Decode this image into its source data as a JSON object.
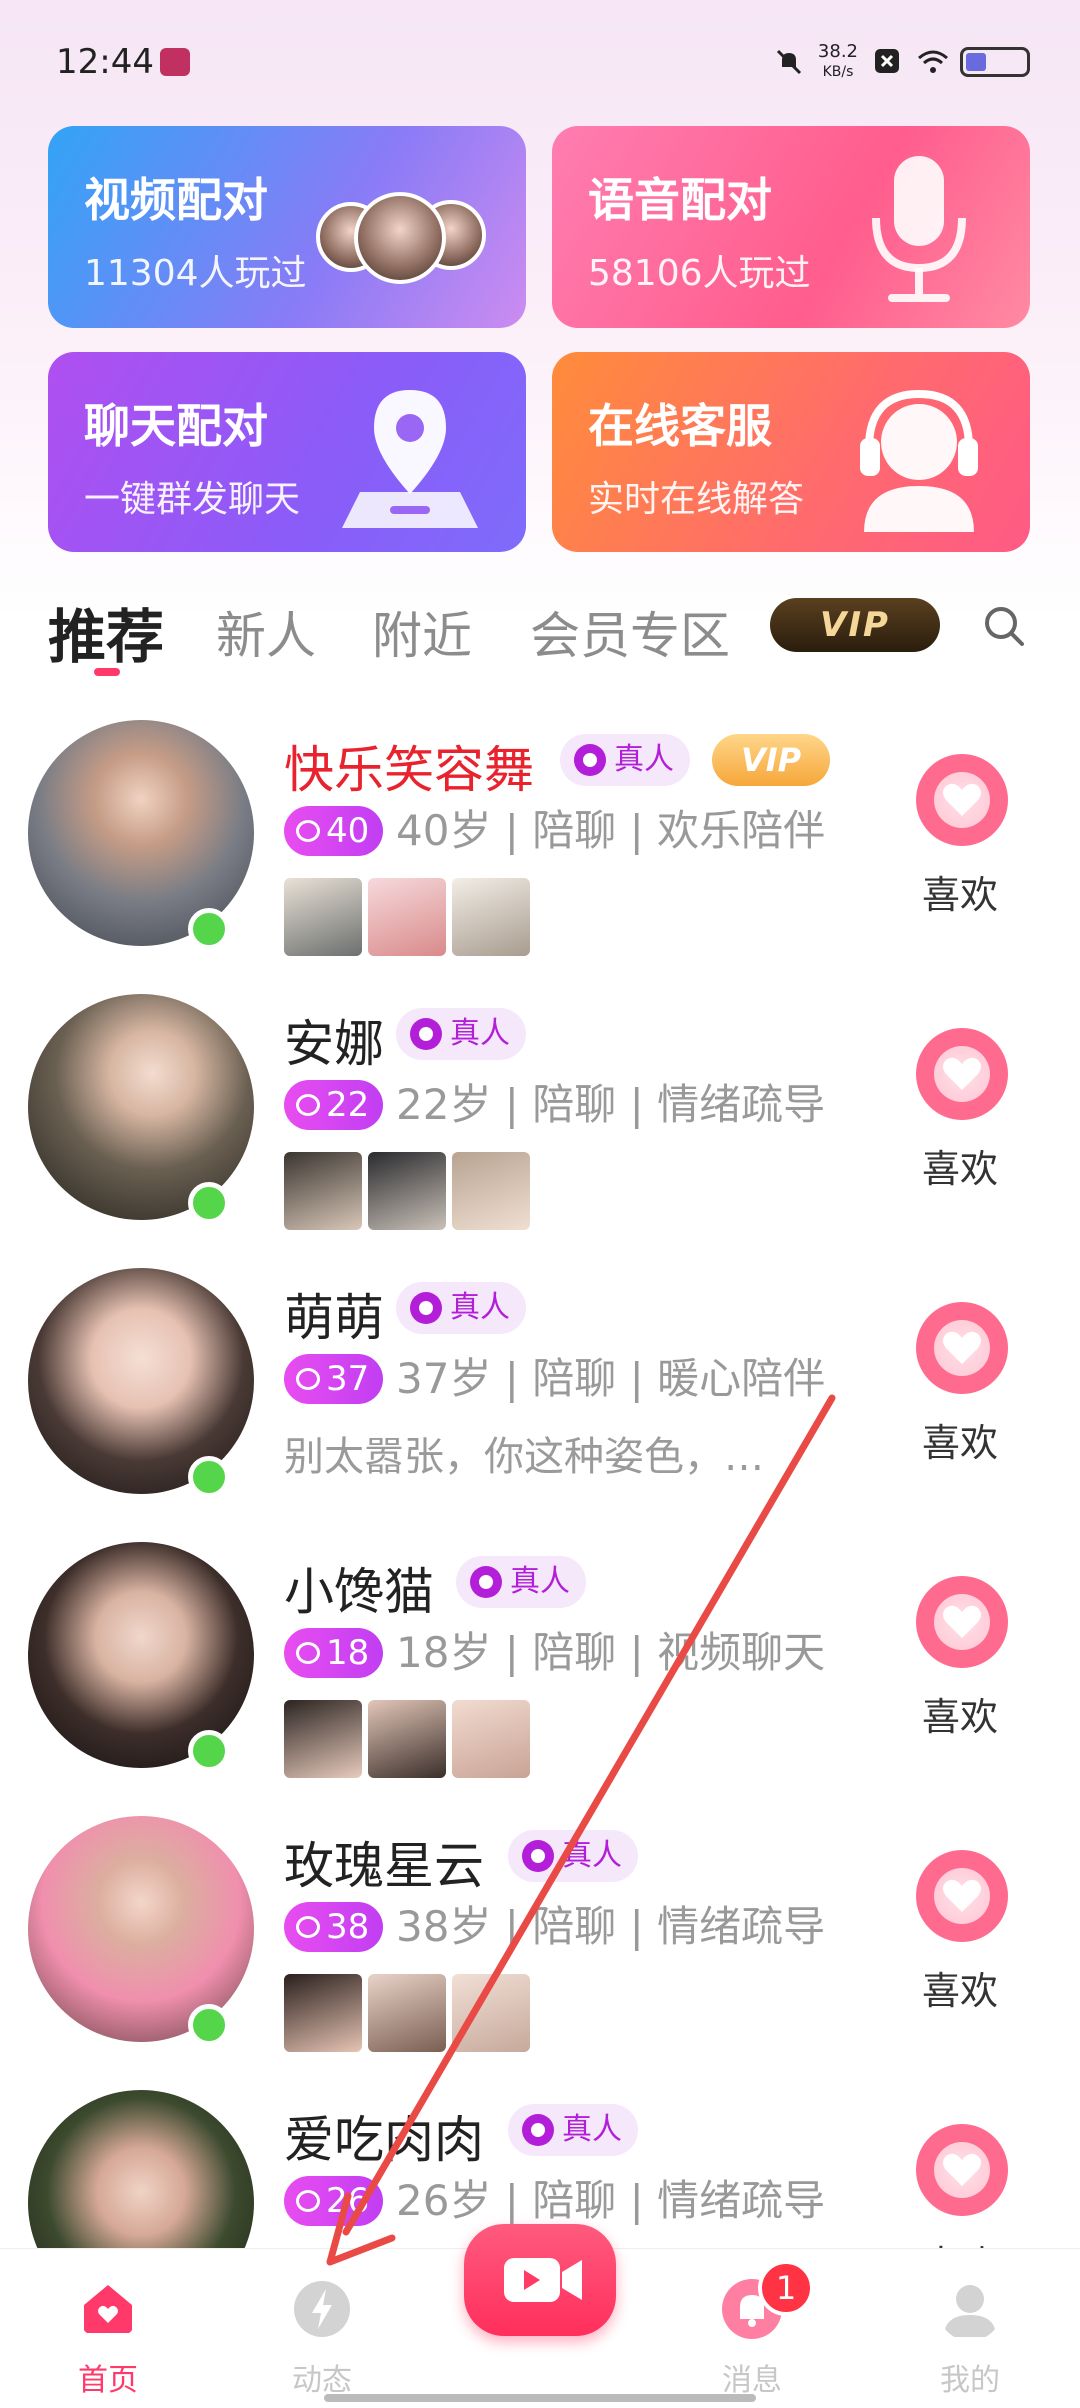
{
  "status_bar": {
    "time": "12:44",
    "net_speed": "38.2",
    "net_unit": "KB/s"
  },
  "cards": [
    {
      "title": "视频配对",
      "subtitle": "11304人玩过",
      "icon": "avatar-cluster"
    },
    {
      "title": "语音配对",
      "subtitle": "58106人玩过",
      "icon": "microphone-icon"
    },
    {
      "title": "聊天配对",
      "subtitle": "一键群发聊天",
      "icon": "location-pin-icon"
    },
    {
      "title": "在线客服",
      "subtitle": "实时在线解答",
      "icon": "headset-icon"
    }
  ],
  "tabs": {
    "items": [
      "推荐",
      "新人",
      "附近",
      "会员专区"
    ],
    "vip_label": "VIP",
    "active_index": 0
  },
  "profiles": [
    {
      "name": "快乐笑容舞",
      "real": "真人",
      "vip": "VIP",
      "age_num": "40",
      "info": "40岁 | 陪聊 | 欢乐陪伴",
      "like": "喜欢",
      "online": true
    },
    {
      "name": "安娜",
      "real": "真人",
      "age_num": "22",
      "info": "22岁 | 陪聊 | 情绪疏导",
      "like": "喜欢",
      "online": true
    },
    {
      "name": "萌萌",
      "real": "真人",
      "age_num": "37",
      "info": "37岁 | 陪聊 | 暖心陪伴",
      "bio": "别太嚣张，你这种姿色，…",
      "like": "喜欢",
      "online": true
    },
    {
      "name": "小馋猫",
      "real": "真人",
      "age_num": "18",
      "info": "18岁 | 陪聊 | 视频聊天",
      "like": "喜欢",
      "online": true
    },
    {
      "name": "玫瑰星云",
      "real": "真人",
      "age_num": "38",
      "info": "38岁 | 陪聊 | 情绪疏导",
      "like": "喜欢",
      "online": true
    },
    {
      "name": "爱吃肉肉",
      "real": "真人",
      "age_num": "26",
      "info": "26岁 | 陪聊 | 情绪疏导",
      "like": "喜欢",
      "online": true
    }
  ],
  "bottom_nav": {
    "items": [
      "首页",
      "动态",
      "消息",
      "我的"
    ],
    "message_badge": "1"
  },
  "colors": {
    "accent": "#ff3a6a",
    "real_badge": "#b31ed8",
    "online": "#55d64a"
  }
}
